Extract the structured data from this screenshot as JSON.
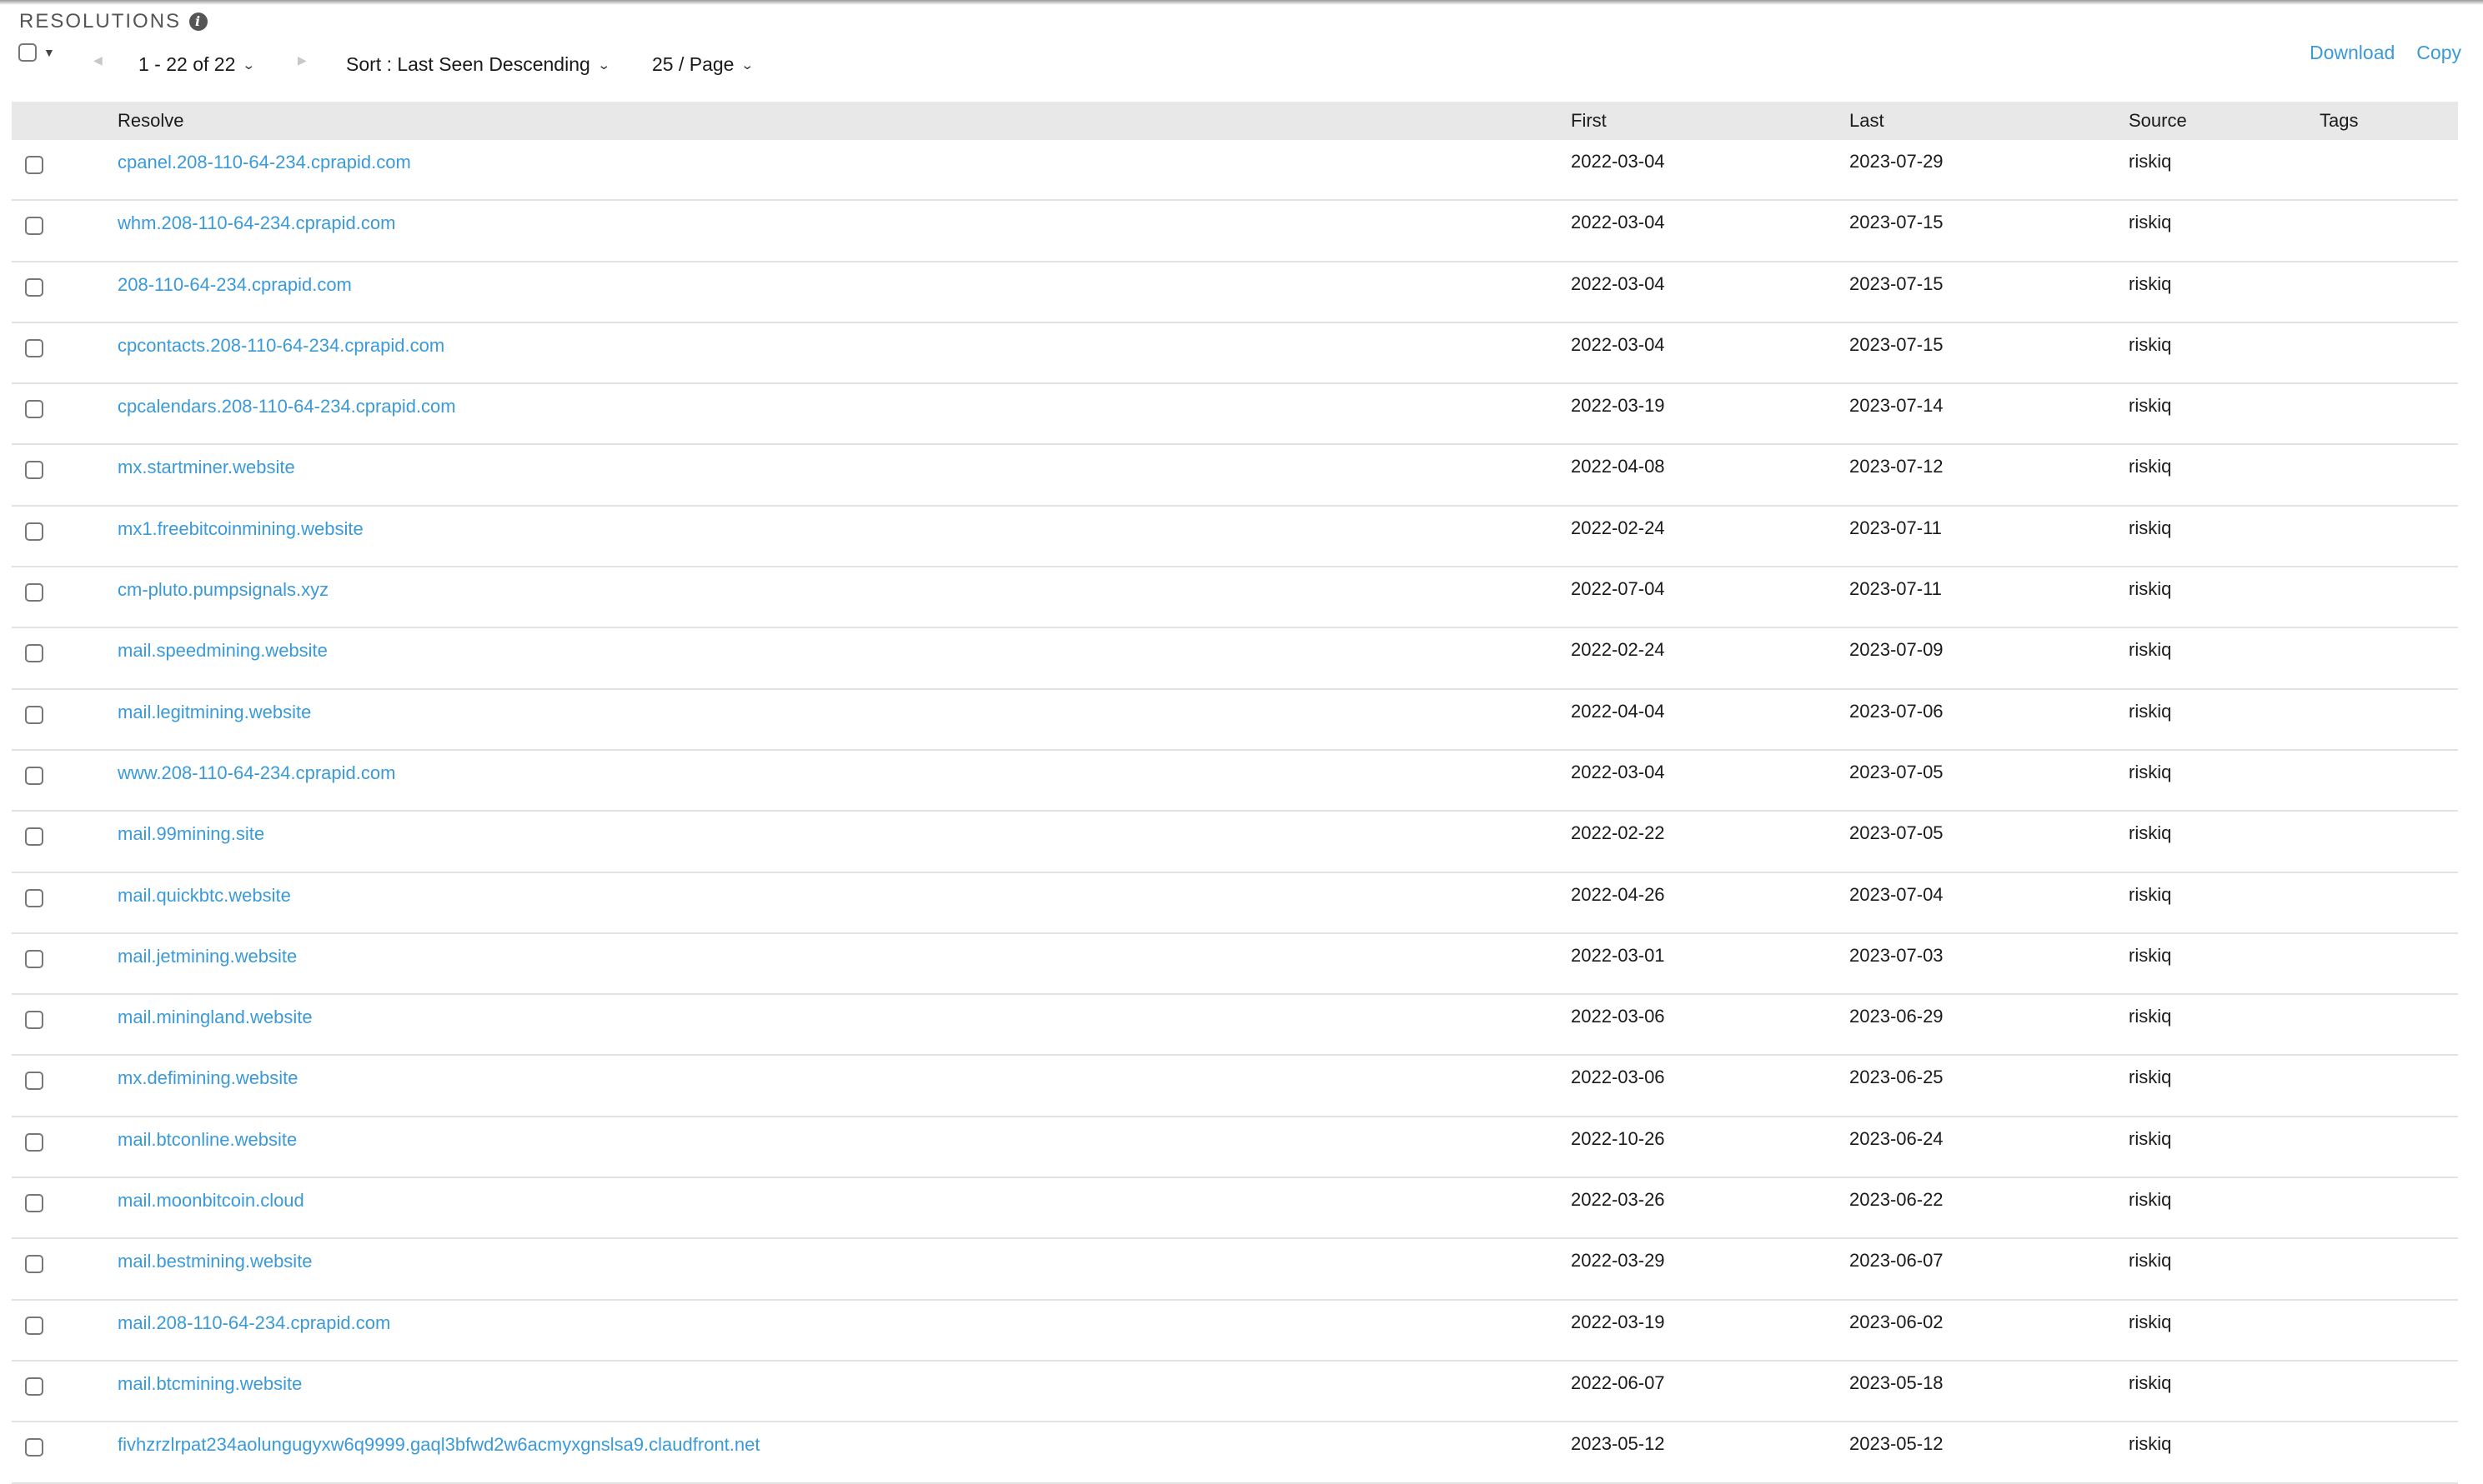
{
  "section": {
    "title": "RESOLUTIONS",
    "info_icon": "info-icon"
  },
  "toolbar": {
    "select_all_icon": "caret-down-icon",
    "prev_icon": "triangle-left-icon",
    "next_icon": "triangle-right-icon",
    "pager_range": "1 - 22 of 22",
    "sort_label": "Sort : Last Seen Descending",
    "page_size": "25 / Page",
    "download_label": "Download",
    "copy_label": "Copy"
  },
  "colors": {
    "link": "#3a9ad9",
    "header_bg": "#e8e8e8",
    "row_divider": "#e2e2e2"
  },
  "table": {
    "columns": [
      "Resolve",
      "First",
      "Last",
      "Source",
      "Tags"
    ],
    "rows": [
      {
        "resolve": "cpanel.208-110-64-234.cprapid.com",
        "first": "2022-03-04",
        "last": "2023-07-29",
        "source": "riskiq",
        "tags": ""
      },
      {
        "resolve": "whm.208-110-64-234.cprapid.com",
        "first": "2022-03-04",
        "last": "2023-07-15",
        "source": "riskiq",
        "tags": ""
      },
      {
        "resolve": "208-110-64-234.cprapid.com",
        "first": "2022-03-04",
        "last": "2023-07-15",
        "source": "riskiq",
        "tags": ""
      },
      {
        "resolve": "cpcontacts.208-110-64-234.cprapid.com",
        "first": "2022-03-04",
        "last": "2023-07-15",
        "source": "riskiq",
        "tags": ""
      },
      {
        "resolve": "cpcalendars.208-110-64-234.cprapid.com",
        "first": "2022-03-19",
        "last": "2023-07-14",
        "source": "riskiq",
        "tags": ""
      },
      {
        "resolve": "mx.startminer.website",
        "first": "2022-04-08",
        "last": "2023-07-12",
        "source": "riskiq",
        "tags": ""
      },
      {
        "resolve": "mx1.freebitcoinmining.website",
        "first": "2022-02-24",
        "last": "2023-07-11",
        "source": "riskiq",
        "tags": ""
      },
      {
        "resolve": "cm-pluto.pumpsignals.xyz",
        "first": "2022-07-04",
        "last": "2023-07-11",
        "source": "riskiq",
        "tags": ""
      },
      {
        "resolve": "mail.speedmining.website",
        "first": "2022-02-24",
        "last": "2023-07-09",
        "source": "riskiq",
        "tags": ""
      },
      {
        "resolve": "mail.legitmining.website",
        "first": "2022-04-04",
        "last": "2023-07-06",
        "source": "riskiq",
        "tags": ""
      },
      {
        "resolve": "www.208-110-64-234.cprapid.com",
        "first": "2022-03-04",
        "last": "2023-07-05",
        "source": "riskiq",
        "tags": ""
      },
      {
        "resolve": "mail.99mining.site",
        "first": "2022-02-22",
        "last": "2023-07-05",
        "source": "riskiq",
        "tags": ""
      },
      {
        "resolve": "mail.quickbtc.website",
        "first": "2022-04-26",
        "last": "2023-07-04",
        "source": "riskiq",
        "tags": ""
      },
      {
        "resolve": "mail.jetmining.website",
        "first": "2022-03-01",
        "last": "2023-07-03",
        "source": "riskiq",
        "tags": ""
      },
      {
        "resolve": "mail.miningland.website",
        "first": "2022-03-06",
        "last": "2023-06-29",
        "source": "riskiq",
        "tags": ""
      },
      {
        "resolve": "mx.defimining.website",
        "first": "2022-03-06",
        "last": "2023-06-25",
        "source": "riskiq",
        "tags": ""
      },
      {
        "resolve": "mail.btconline.website",
        "first": "2022-10-26",
        "last": "2023-06-24",
        "source": "riskiq",
        "tags": ""
      },
      {
        "resolve": "mail.moonbitcoin.cloud",
        "first": "2022-03-26",
        "last": "2023-06-22",
        "source": "riskiq",
        "tags": ""
      },
      {
        "resolve": "mail.bestmining.website",
        "first": "2022-03-29",
        "last": "2023-06-07",
        "source": "riskiq",
        "tags": ""
      },
      {
        "resolve": "mail.208-110-64-234.cprapid.com",
        "first": "2022-03-19",
        "last": "2023-06-02",
        "source": "riskiq",
        "tags": ""
      },
      {
        "resolve": "mail.btcmining.website",
        "first": "2022-06-07",
        "last": "2023-05-18",
        "source": "riskiq",
        "tags": ""
      },
      {
        "resolve": "fivhzrzlrpat234aolungugyxw6q9999.gaql3bfwd2w6acmyxgnslsa9.claudfront.net",
        "first": "2023-05-12",
        "last": "2023-05-12",
        "source": "riskiq",
        "tags": ""
      }
    ]
  }
}
